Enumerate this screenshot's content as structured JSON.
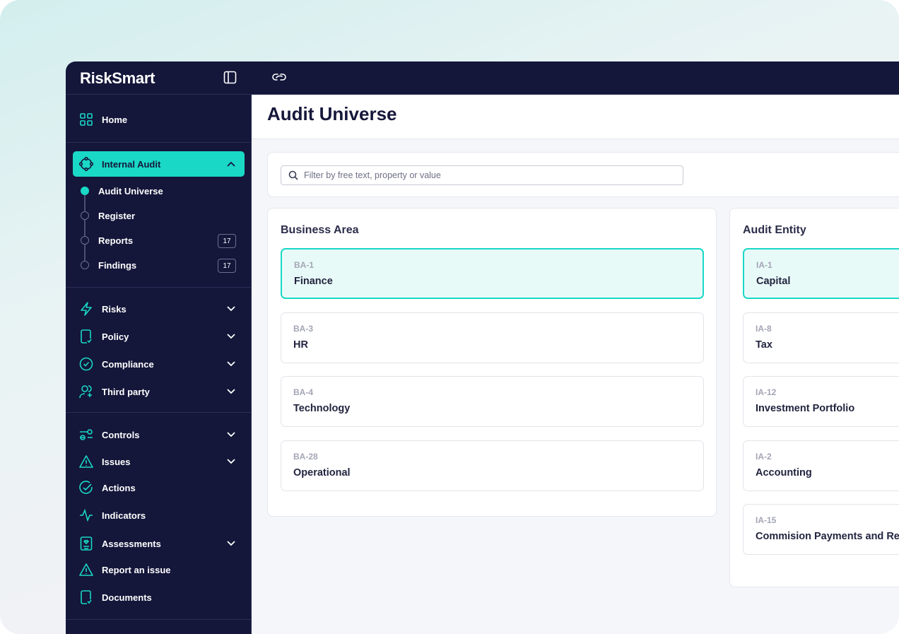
{
  "app": {
    "logo": "RiskSmart"
  },
  "colors": {
    "navy": "#14163a",
    "accent": "#1ad8c6"
  },
  "sidebar": {
    "home": "Home",
    "internal_audit": "Internal Audit",
    "sub_items": [
      {
        "label": "Audit Universe",
        "active": true
      },
      {
        "label": "Register"
      },
      {
        "label": "Reports",
        "badge": "17"
      },
      {
        "label": "Findings",
        "badge": "17"
      }
    ],
    "group1": [
      {
        "label": "Risks",
        "icon": "bolt-icon"
      },
      {
        "label": "Policy",
        "icon": "document-check-icon"
      },
      {
        "label": "Compliance",
        "icon": "badge-check-icon"
      },
      {
        "label": "Third party",
        "icon": "user-plus-icon"
      }
    ],
    "group2": [
      {
        "label": "Controls",
        "icon": "toggle-icon"
      },
      {
        "label": "Issues",
        "icon": "warning-icon"
      },
      {
        "label": "Actions",
        "icon": "check-circle-icon"
      },
      {
        "label": "Indicators",
        "icon": "pulse-icon"
      },
      {
        "label": "Assessments",
        "icon": "clipboard-icon"
      },
      {
        "label": "Report an issue",
        "icon": "warning-icon"
      },
      {
        "label": "Documents",
        "icon": "document-check-icon"
      }
    ]
  },
  "main": {
    "title": "Audit Universe",
    "search_placeholder": "Filter by free text, property or value",
    "business_area": {
      "title": "Business Area",
      "items": [
        {
          "code": "BA-1",
          "name": "Finance",
          "selected": true
        },
        {
          "code": "BA-3",
          "name": "HR"
        },
        {
          "code": "BA-4",
          "name": "Technology"
        },
        {
          "code": "BA-28",
          "name": "Operational"
        }
      ]
    },
    "audit_entity": {
      "title": "Audit Entity",
      "items": [
        {
          "code": "IA-1",
          "name": "Capital",
          "selected": true
        },
        {
          "code": "IA-8",
          "name": "Tax"
        },
        {
          "code": "IA-12",
          "name": "Investment Portfolio"
        },
        {
          "code": "IA-2",
          "name": "Accounting"
        },
        {
          "code": "IA-15",
          "name": "Commision Payments and Re"
        }
      ]
    }
  }
}
